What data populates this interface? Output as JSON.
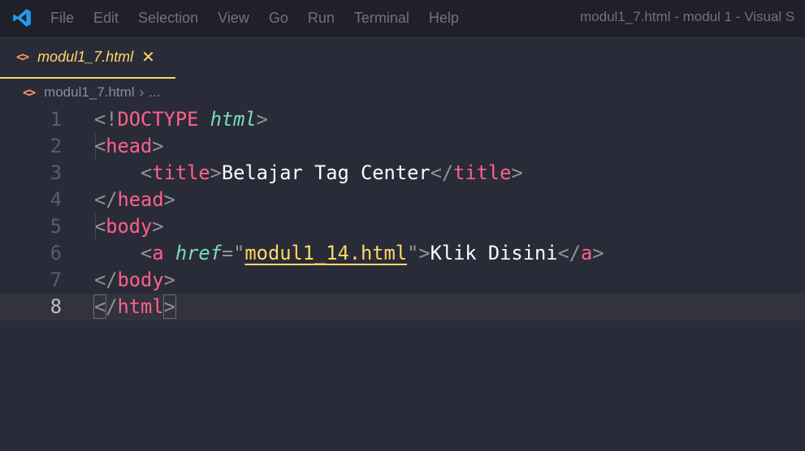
{
  "menu": [
    "File",
    "Edit",
    "Selection",
    "View",
    "Go",
    "Run",
    "Terminal",
    "Help"
  ],
  "window_title": "modul1_7.html - modul 1 - Visual S",
  "tab": {
    "label": "modul1_7.html",
    "close": "✕"
  },
  "breadcrumb": {
    "file": "modul1_7.html",
    "sep": "›",
    "rest": "..."
  },
  "code": {
    "doctype": "<!",
    "doctype_kw": "DOCTYPE",
    "html_kw": "html",
    "head": "head",
    "title": "title",
    "title_text": "Belajar Tag Center",
    "body": "body",
    "a": "a",
    "href": "href",
    "href_val": "modul1_14.html",
    "link_text": "Klik Disini",
    "html": "html"
  },
  "line_numbers": [
    "1",
    "2",
    "3",
    "4",
    "5",
    "6",
    "7",
    "8"
  ],
  "current_line": 8
}
